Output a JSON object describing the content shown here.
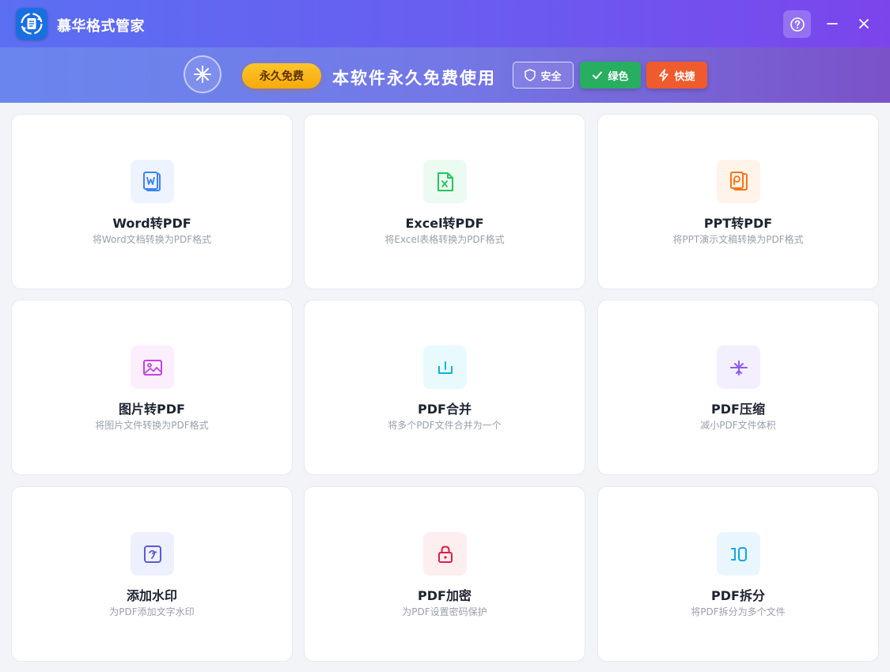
{
  "app": {
    "title": "慕华格式管家",
    "logo_icon": "document-convert-icon"
  },
  "banner": {
    "badge": "永久免费",
    "headline": "本软件永久免费使用",
    "tags": {
      "safe": "安全",
      "green": "绿色",
      "fast": "快捷"
    }
  },
  "colors": {
    "titlebar_start": "#5b6ff2",
    "titlebar_end": "#7b45ec",
    "badge_yellow": "#f6a90c",
    "tag_green": "#27ae60",
    "tag_orange": "#ef5b2c"
  },
  "cards": [
    {
      "title": "Word转PDF",
      "desc": "将Word文档转换为PDF格式",
      "icon": "word-file-icon",
      "color": "#3b82f6"
    },
    {
      "title": "Excel转PDF",
      "desc": "将Excel表格转换为PDF格式",
      "icon": "excel-file-icon",
      "color": "#22c55e"
    },
    {
      "title": "PPT转PDF",
      "desc": "将PPT演示文稿转换为PDF格式",
      "icon": "ppt-file-icon",
      "color": "#f97316"
    },
    {
      "title": "图片转PDF",
      "desc": "将图片文件转换为PDF格式",
      "icon": "image-icon",
      "color": "#c044e0"
    },
    {
      "title": "PDF合并",
      "desc": "将多个PDF文件合并为一个",
      "icon": "merge-icon",
      "color": "#06b6d4"
    },
    {
      "title": "PDF压缩",
      "desc": "减小PDF文件体积",
      "icon": "compress-icon",
      "color": "#8b5cf6"
    },
    {
      "title": "添加水印",
      "desc": "为PDF添加文字水印",
      "icon": "watermark-icon",
      "color": "#5b5bd6"
    },
    {
      "title": "PDF加密",
      "desc": "为PDF设置密码保护",
      "icon": "lock-icon",
      "color": "#e11d48"
    },
    {
      "title": "PDF拆分",
      "desc": "将PDF拆分为多个文件",
      "icon": "split-icon",
      "color": "#0ea5e9"
    }
  ]
}
